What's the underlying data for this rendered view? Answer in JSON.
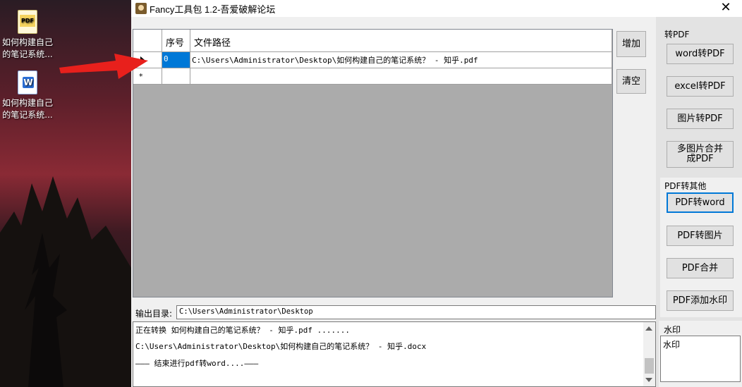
{
  "desktop": {
    "icons": [
      {
        "label_line1": "如何构建自己",
        "label_line2": "的笔记系统...",
        "icon": "pdf-file-icon",
        "badge": "PDF"
      },
      {
        "label_line1": "如何构建自己",
        "label_line2": "的笔记系统...",
        "icon": "word-file-icon",
        "badge": "W"
      }
    ]
  },
  "window": {
    "title": "Fancy工具包 1.2-吾爱破解论坛",
    "close_glyph": "✕"
  },
  "grid": {
    "columns": [
      "序号",
      "文件路径"
    ],
    "rows": [
      {
        "num": "0",
        "path": "C:\\Users\\Administrator\\Desktop\\如何构建自己的笔记系统？ - 知乎.pdf"
      }
    ],
    "new_row_marker": "*"
  },
  "buttons": {
    "add": "增加",
    "clear": "清空"
  },
  "to_pdf": {
    "label": "转PDF",
    "word": "word转PDF",
    "excel": "excel转PDF",
    "image": "图片转PDF",
    "multi_line1": "多图片合并",
    "multi_line2": "成PDF"
  },
  "pdf_to_other": {
    "label": "PDF转其他",
    "to_word": "PDF转word",
    "to_image": "PDF转图片",
    "merge": "PDF合并",
    "watermark": "PDF添加水印"
  },
  "watermark": {
    "label": "水印",
    "value": "水印"
  },
  "output": {
    "label": "输出目录:",
    "value": "C:\\Users\\Administrator\\Desktop"
  },
  "log": {
    "lines": [
      "正在转换 如何构建自己的笔记系统？ - 知乎.pdf .......",
      "C:\\Users\\Administrator\\Desktop\\如何构建自己的笔记系统？ - 知乎.docx",
      "——— 结束进行pdf转word....———"
    ]
  },
  "colors": {
    "selection": "#0078d7",
    "arrow": "#e8201c"
  }
}
